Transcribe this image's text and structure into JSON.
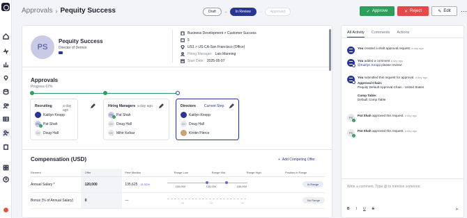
{
  "header": {
    "breadcrumb_root": "Approvals",
    "breadcrumb_sep": "›",
    "breadcrumb_current": "Pequity Success",
    "steps": [
      "Draft",
      "In Review",
      "Approved"
    ],
    "approve_label": "Approve",
    "reject_label": "Reject",
    "edit_label": "Edit",
    "more_label": "⋯"
  },
  "profile": {
    "initials": "PS",
    "name": "Pequity Success",
    "title": "Director of Demos",
    "meta": [
      {
        "icon": "building-icon",
        "label": "",
        "value": "Business Development > Customer Success"
      },
      {
        "icon": "dollar-icon",
        "label": "",
        "value": "5"
      },
      {
        "icon": "location-icon",
        "label": "",
        "value": "US1 > US-CA-San Francisco (Office)"
      },
      {
        "icon": "hiring-manager-icon",
        "label": "Hiring Manager:",
        "value": "Lais Manning"
      },
      {
        "icon": "calendar-icon",
        "label": "Start Date:",
        "value": "2025-05-07"
      }
    ]
  },
  "approvals": {
    "title": "Approvals",
    "progress": "Progress 67%",
    "progress_value": 0.67,
    "cards": [
      {
        "title": "Recruiting",
        "time": "a day ago",
        "current": "",
        "people": [
          {
            "initials": "",
            "name": "Kaitlyn Knopp",
            "style": "navy"
          },
          {
            "initials": "PS",
            "name": "Pat Shah",
            "style": "blue ok"
          },
          {
            "initials": "DH",
            "name": "Doug Hall",
            "style": "gray"
          }
        ]
      },
      {
        "title": "Hiring Managers",
        "time": "a day ago",
        "current": "",
        "people": [
          {
            "initials": "PS",
            "name": "Pat Shah",
            "style": "blue ok"
          },
          {
            "initials": "DH",
            "name": "Doug Hall",
            "style": "gray"
          },
          {
            "initials": "MK",
            "name": "Mihir Kelkar",
            "style": "gray"
          }
        ]
      },
      {
        "title": "Directors",
        "time": "",
        "current": "Current Step",
        "people": [
          {
            "initials": "",
            "name": "Kaitlyn Knopp",
            "style": "navy"
          },
          {
            "initials": "DH",
            "name": "Doug Hall",
            "style": "gray"
          },
          {
            "initials": "",
            "name": "Kirstin Pierce",
            "style": "photo"
          }
        ]
      }
    ]
  },
  "compensation": {
    "title": "Compensation (USD)",
    "add_link": "Add Competing Offer",
    "columns": [
      "Element",
      "Offer",
      "Peer Median",
      "Range Low",
      "Range Mid",
      "Range High",
      "Position in Range"
    ],
    "rows": [
      {
        "element": "Annual Salary *",
        "offer": "120,000",
        "peer_median": "135,625",
        "delta": "-11.52%",
        "low": "100,000",
        "mid": "125,000",
        "high": "150,000",
        "position": "In Range",
        "offer_marker": 120000
      },
      {
        "element": "Bonus (% of Annual Salary)",
        "offer": "0",
        "peer_median": "—",
        "delta": "",
        "low": "—",
        "mid": "—",
        "high": "—",
        "position": "No Range",
        "offer_marker": null
      }
    ]
  },
  "activity": {
    "tabs": [
      "All Activity",
      "Comments",
      "Actions"
    ],
    "items": [
      {
        "actor": "You",
        "text": "created a draft approval request.",
        "ago": "a day ago"
      },
      {
        "actor": "You",
        "text": "added a comment",
        "ago": "a day ago",
        "mention": "@Kaitlyn Knopp",
        "mention_suffix": "please review!"
      },
      {
        "actor": "You",
        "text": "submitted this request for approval.",
        "ago": "a day ago",
        "chain_label": "Approval Chain:",
        "chain_value": "Pequity Default Approval Chain - United States",
        "table_label": "Comp Table:",
        "table_value": "Default Comp Table"
      },
      {
        "actor": "Pat Shah",
        "text": "approved this request.",
        "ago": "a day ago",
        "initials": "PS"
      },
      {
        "actor": "Pat Shah",
        "text": "approved this request.",
        "ago": "a day ago",
        "initials": "PS"
      }
    ],
    "composer_placeholder": "Write a comment. Type @ to mention someone.",
    "toolbar": [
      "B",
      "I",
      "U",
      "S"
    ],
    "send": "➤"
  },
  "colors": {
    "primary": "#283593",
    "approve": "#2e9e5b",
    "reject": "#e44848"
  }
}
